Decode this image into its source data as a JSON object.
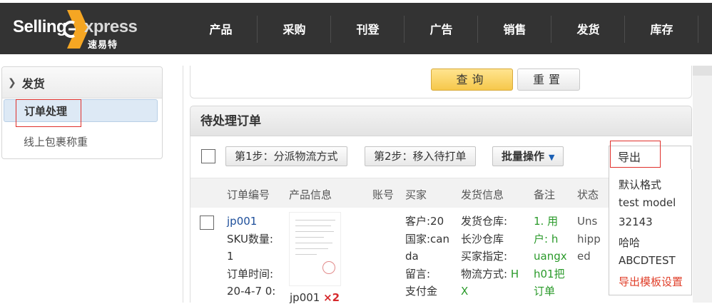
{
  "brand": {
    "name_part1": "Selling",
    "name_part2": "xpress",
    "chinese": "速易特",
    "accent": "#f5a623"
  },
  "nav": [
    "产品",
    "采购",
    "刊登",
    "广告",
    "销售",
    "发货",
    "库存"
  ],
  "sidebar": {
    "section": "发货",
    "items": [
      "订单处理",
      "线上包裹称重"
    ]
  },
  "search": {
    "query_label": "查询",
    "reset_label": "重置"
  },
  "orders": {
    "title": "待处理订单",
    "toolbar": {
      "step1": "第1步：分派物流方式",
      "step2": "第2步：移入待打单",
      "bulk": "批量操作"
    },
    "columns": [
      "订单编号",
      "产品信息",
      "账号",
      "买家",
      "发货信息",
      "备注",
      "状态"
    ],
    "row": {
      "order_id": "jp001",
      "sku_label": "SKU数量:",
      "sku_value": "1",
      "time_label": "订单时间:",
      "time_value": "20-4-7 0:",
      "product_sku": "jp001",
      "product_qty": "×2",
      "buyer": [
        "客户:20",
        "国家:can",
        "da",
        "留言:",
        "支付金"
      ],
      "ship": [
        "发货仓库:",
        "长沙仓库",
        "买家指定:",
        "物流方式: H",
        "X"
      ],
      "ship_method_value": "H",
      "ship_method_cont": "X",
      "remark": [
        "1. 用",
        "户: h",
        "uangx",
        "h01把",
        "订单"
      ],
      "status": [
        "Uns",
        "hipp",
        "ed"
      ]
    }
  },
  "export": {
    "label": "导出",
    "options": [
      "默认格式",
      "test model",
      "32143",
      "哈哈",
      "ABCDTEST"
    ],
    "settings": "导出模板设置"
  }
}
